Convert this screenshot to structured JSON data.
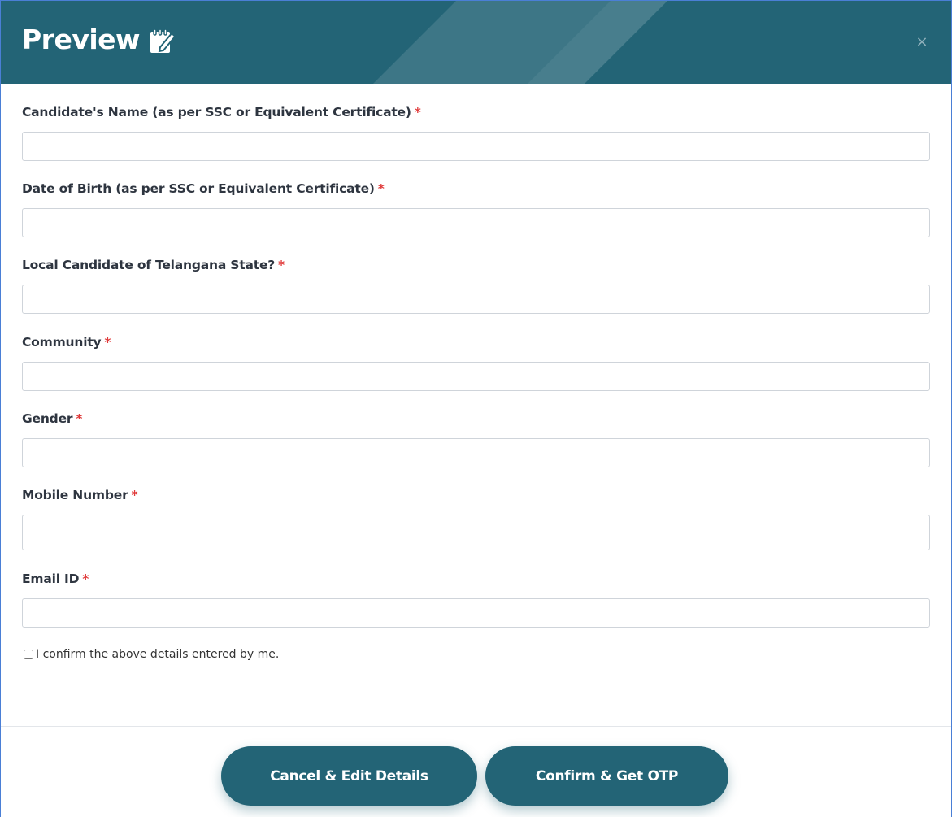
{
  "header": {
    "title": "Preview",
    "title_icon": "edit-note-icon",
    "close_icon": "close-icon",
    "close_label": "×",
    "bg_color": "#236476"
  },
  "fields": [
    {
      "label": "Candidate's Name (as per SSC or Equivalent Certificate)",
      "required": "*",
      "value": ""
    },
    {
      "label": "Date of Birth (as per SSC or Equivalent Certificate)",
      "required": "*",
      "value": ""
    },
    {
      "label": "Local Candidate of Telangana State?",
      "required": "*",
      "value": ""
    },
    {
      "label": "Community",
      "required": "*",
      "value": ""
    },
    {
      "label": "Gender",
      "required": "*",
      "value": ""
    },
    {
      "label": "Mobile Number",
      "required": "*",
      "value": ""
    },
    {
      "label": "Email ID",
      "required": "*",
      "value": ""
    }
  ],
  "confirm": {
    "label": "I confirm the above details entered by me.",
    "checked": false
  },
  "buttons": {
    "cancel_label": "Cancel & Edit Details",
    "confirm_label": "Confirm & Get OTP"
  },
  "colors": {
    "accent": "#236476",
    "required": "#e03b3b"
  }
}
